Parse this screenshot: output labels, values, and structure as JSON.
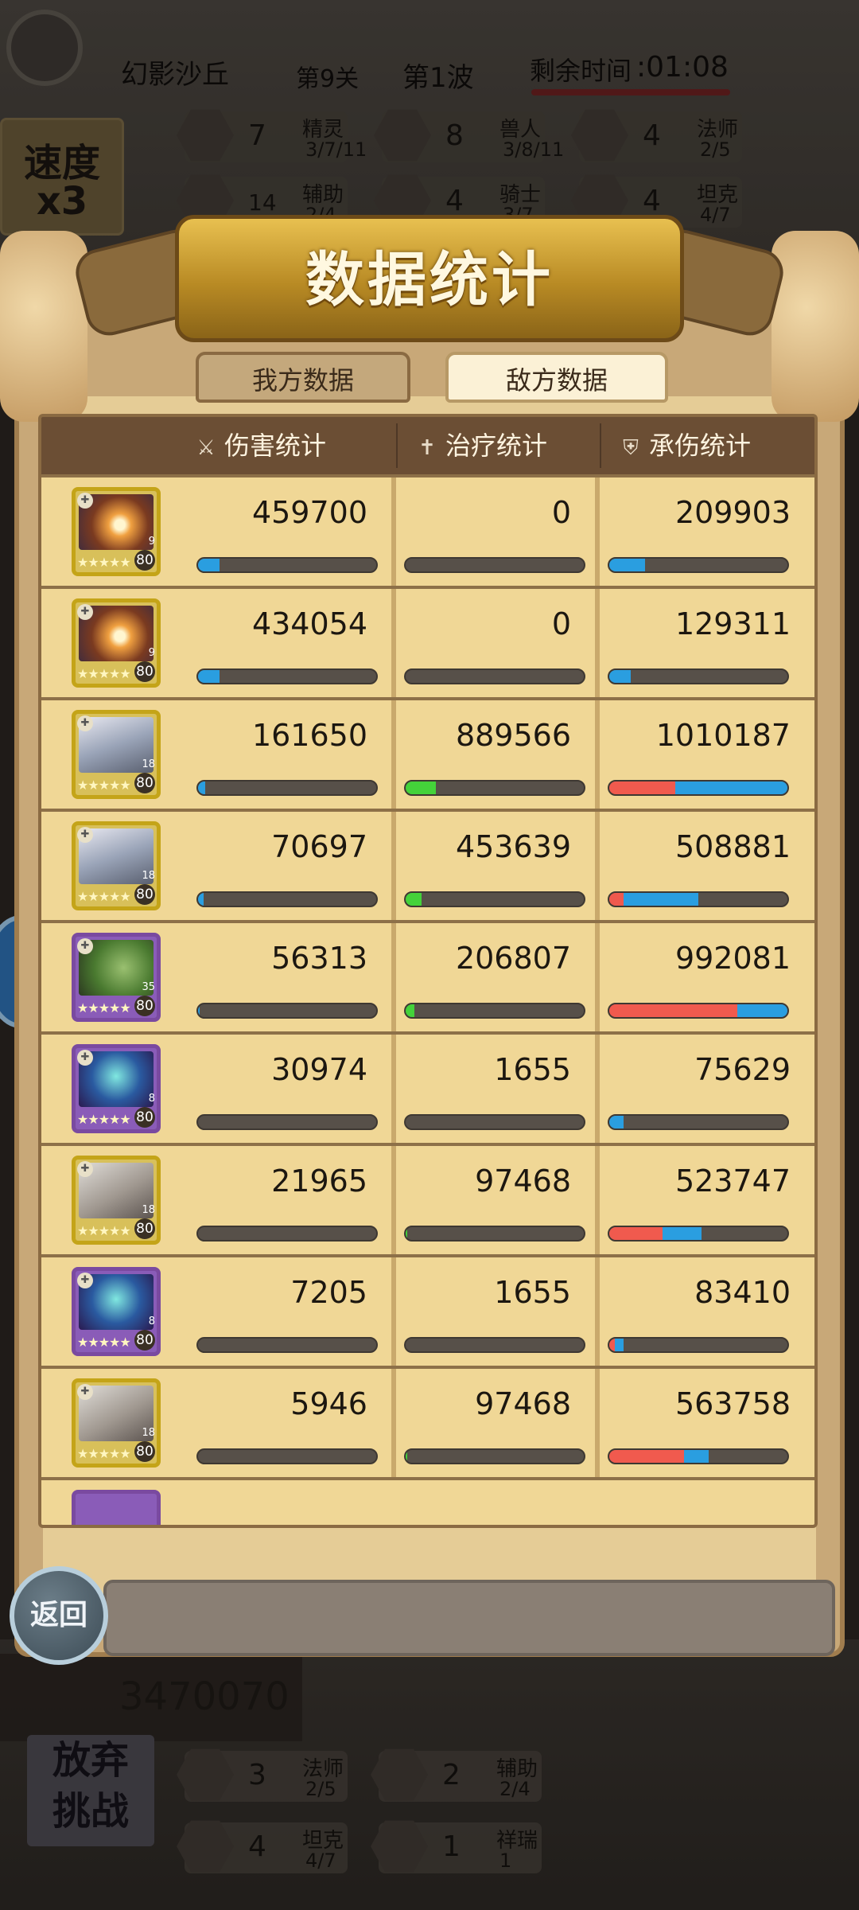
{
  "hud": {
    "stage_name": "幻影沙丘",
    "level": "第9关",
    "wave": "第1波",
    "time_label": "剩余时间",
    "time_value": ":01:08",
    "speed_label": "速度",
    "speed_value": "x3",
    "enemy_traits": [
      {
        "icon": "elf-emblem-icon",
        "count": "7",
        "name": "精灵",
        "progress": "3/7/11"
      },
      {
        "icon": "beastman-emblem-icon",
        "count": "8",
        "name": "兽人",
        "progress": "3/8/11"
      },
      {
        "icon": "mage-emblem-icon",
        "count": "4",
        "name": "法师",
        "progress": "2/5"
      },
      {
        "icon": "support-emblem-icon",
        "count": "14",
        "name": "辅助",
        "progress": "2/4"
      },
      {
        "icon": "knight-emblem-icon",
        "count": "4",
        "name": "骑士",
        "progress": "3/7"
      },
      {
        "icon": "tank-emblem-icon",
        "count": "4",
        "name": "坦克",
        "progress": "4/7"
      }
    ],
    "score": "3470070",
    "give_up_label": "放弃挑战",
    "give_up_line1": "放弃",
    "give_up_line2": "挑战",
    "ally_traits": [
      {
        "icon": "mage-emblem-icon",
        "count": "3",
        "name": "法师",
        "progress": "2/5"
      },
      {
        "icon": "support-emblem-icon",
        "count": "2",
        "name": "辅助",
        "progress": "2/4"
      },
      {
        "icon": "tank-emblem-icon",
        "count": "4",
        "name": "坦克",
        "progress": "4/7"
      },
      {
        "icon": "auspicious-emblem-icon",
        "count": "1",
        "name": "祥瑞",
        "progress": "1"
      }
    ]
  },
  "modal": {
    "title": "数据统计",
    "tabs": [
      {
        "label": "我方数据",
        "active": false
      },
      {
        "label": "敌方数据",
        "active": true
      }
    ],
    "columns": [
      {
        "label": "伤害统计",
        "icon": "sword-icon"
      },
      {
        "label": "治疗统计",
        "icon": "cross-icon"
      },
      {
        "label": "承伤统计",
        "icon": "shield-icon"
      }
    ],
    "back_label": "返回",
    "colors": {
      "damage": "#2a9ee0",
      "heal": "#44d23a",
      "physical": "#f05a4e",
      "magic": "#2a9ee0"
    },
    "rows": [
      {
        "hero": "fire-sorceress",
        "frame": "gold",
        "level": "80",
        "stars": "★★★★★",
        "badge": "9",
        "damage": "459700",
        "heal": "0",
        "taken": "209903",
        "damage_fill": 0.12,
        "heal_fill": 0,
        "taken_red": 0,
        "taken_blue": 0.2
      },
      {
        "hero": "fire-sorceress",
        "frame": "gold",
        "level": "80",
        "stars": "★★★★★",
        "badge": "9",
        "damage": "434054",
        "heal": "0",
        "taken": "129311",
        "damage_fill": 0.12,
        "heal_fill": 0,
        "taken_red": 0,
        "taken_blue": 0.12
      },
      {
        "hero": "armored-paladin",
        "frame": "gold",
        "level": "80",
        "stars": "★★★★★",
        "badge": "18",
        "damage": "161650",
        "heal": "889566",
        "taken": "1010187",
        "damage_fill": 0.04,
        "heal_fill": 0.17,
        "taken_red": 0.37,
        "taken_blue": 0.63
      },
      {
        "hero": "armored-paladin",
        "frame": "gold",
        "level": "80",
        "stars": "★★★★★",
        "badge": "18",
        "damage": "70697",
        "heal": "453639",
        "taken": "508881",
        "damage_fill": 0.03,
        "heal_fill": 0.09,
        "taken_red": 0.08,
        "taken_blue": 0.42
      },
      {
        "hero": "green-dragon",
        "frame": "purple",
        "level": "80",
        "stars": "★★★★★",
        "badge": "35",
        "damage": "56313",
        "heal": "206807",
        "taken": "992081",
        "damage_fill": 0.01,
        "heal_fill": 0.05,
        "taken_red": 0.72,
        "taken_blue": 0.28
      },
      {
        "hero": "blue-elf-mage",
        "frame": "purple",
        "level": "80",
        "stars": "★★★★★",
        "badge": "8",
        "damage": "30974",
        "heal": "1655",
        "taken": "75629",
        "damage_fill": 0,
        "heal_fill": 0,
        "taken_red": 0,
        "taken_blue": 0.08
      },
      {
        "hero": "silver-knight",
        "frame": "gold",
        "level": "80",
        "stars": "★★★★★",
        "badge": "18",
        "damage": "21965",
        "heal": "97468",
        "taken": "523747",
        "damage_fill": 0,
        "heal_fill": 0.01,
        "taken_red": 0.3,
        "taken_blue": 0.22
      },
      {
        "hero": "blue-elf-mage",
        "frame": "purple",
        "level": "80",
        "stars": "★★★★★",
        "badge": "8",
        "damage": "7205",
        "heal": "1655",
        "taken": "83410",
        "damage_fill": 0,
        "heal_fill": 0,
        "taken_red": 0.03,
        "taken_blue": 0.05
      },
      {
        "hero": "silver-knight",
        "frame": "gold",
        "level": "80",
        "stars": "★★★★★",
        "badge": "18",
        "damage": "5946",
        "heal": "97468",
        "taken": "563758",
        "damage_fill": 0,
        "heal_fill": 0.01,
        "taken_red": 0.42,
        "taken_blue": 0.14
      }
    ]
  }
}
